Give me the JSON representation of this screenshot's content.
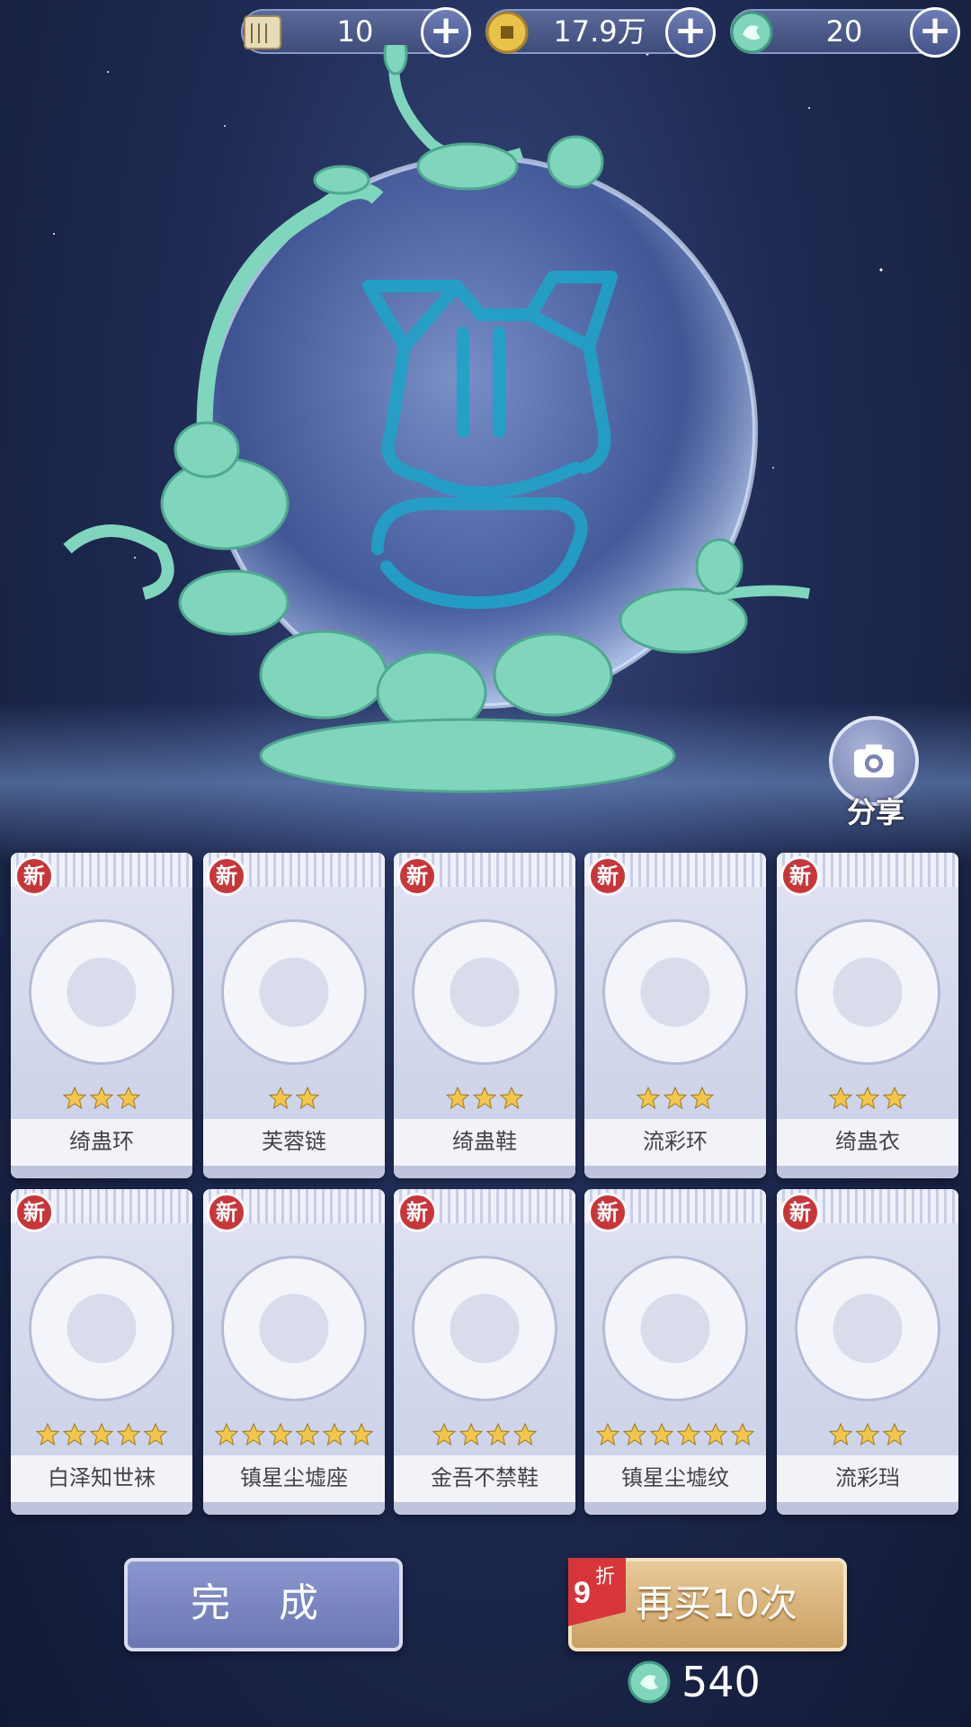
{
  "currencies": [
    {
      "icon": "scroll-icon",
      "value": "10"
    },
    {
      "icon": "gold-coin-icon",
      "value": "17.9万"
    },
    {
      "icon": "jade-dragon-icon",
      "value": "20"
    }
  ],
  "share": {
    "label": "分享",
    "icon": "camera-icon"
  },
  "cards": [
    {
      "badge": "新",
      "name": "绮蛊环",
      "stars": 3
    },
    {
      "badge": "新",
      "name": "芙蓉链",
      "stars": 2
    },
    {
      "badge": "新",
      "name": "绮蛊鞋",
      "stars": 3
    },
    {
      "badge": "新",
      "name": "流彩环",
      "stars": 3
    },
    {
      "badge": "新",
      "name": "绮蛊衣",
      "stars": 3
    },
    {
      "badge": "新",
      "name": "白泽知世袜",
      "stars": 5
    },
    {
      "badge": "新",
      "name": "镇星尘墟座",
      "stars": 6
    },
    {
      "badge": "新",
      "name": "金吾不禁鞋",
      "stars": 4
    },
    {
      "badge": "新",
      "name": "镇星尘墟纹",
      "stars": 6
    },
    {
      "badge": "新",
      "name": "流彩珰",
      "stars": 3
    }
  ],
  "buttons": {
    "done": "完 成",
    "again": "再买10次",
    "discount_num": "9",
    "discount_char": "折",
    "cost": "540"
  },
  "colors": {
    "accent_jade": "#7fd6bd",
    "star": "#f3c64a",
    "badge_red": "#c8363a"
  }
}
